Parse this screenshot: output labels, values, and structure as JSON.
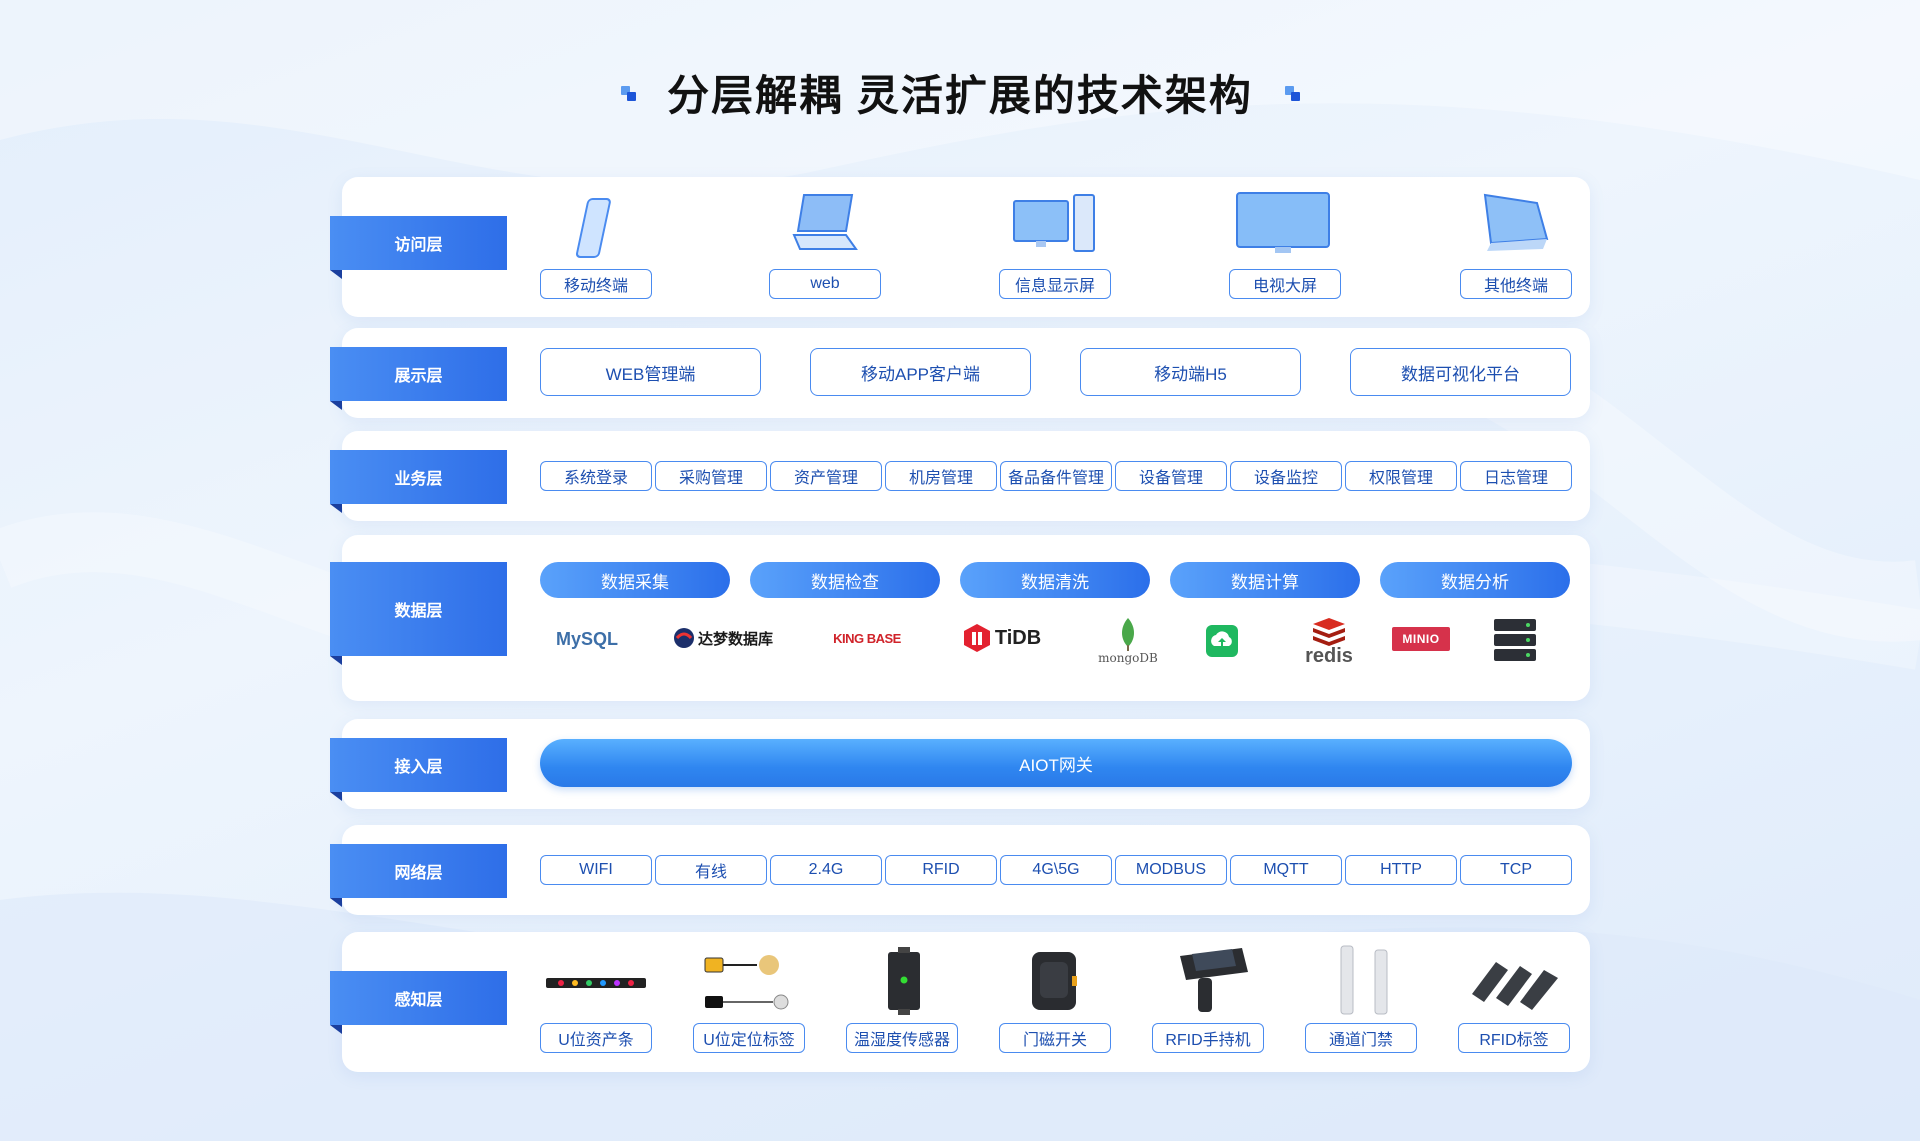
{
  "title": "分层解耦 灵活扩展的技术架构",
  "colors": {
    "primary": "#2e6ee8",
    "pill_border": "#4a8bf0",
    "pill_text": "#1d4fb0"
  },
  "layers": {
    "access": {
      "label": "访问层",
      "items": [
        {
          "label": "移动终端",
          "icon": "mobile-phone-icon"
        },
        {
          "label": "web",
          "icon": "laptop-icon"
        },
        {
          "label": "信息显示屏",
          "icon": "desktop-computer-icon"
        },
        {
          "label": "电视大屏",
          "icon": "tv-screen-icon"
        },
        {
          "label": "其他终端",
          "icon": "tablet-icon"
        }
      ]
    },
    "display": {
      "label": "展示层",
      "items": [
        "WEB管理端",
        "移动APP客户端",
        "移动端H5",
        "数据可视化平台"
      ]
    },
    "business": {
      "label": "业务层",
      "items": [
        "系统登录",
        "采购管理",
        "资产管理",
        "机房管理",
        "备品备件管理",
        "设备管理",
        "设备监控",
        "权限管理",
        "日志管理"
      ]
    },
    "data": {
      "label": "数据层",
      "stages": [
        "数据采集",
        "数据检查",
        "数据清洗",
        "数据计算",
        "数据分析"
      ],
      "logos": [
        {
          "text": "MySQL",
          "icon": "mysql-logo"
        },
        {
          "text": "达梦数据库",
          "icon": "dameng-logo"
        },
        {
          "text": "KING BASE",
          "icon": "kingbase-logo"
        },
        {
          "text": "TiDB",
          "icon": "tidb-logo"
        },
        {
          "text": "mongoDB",
          "icon": "mongodb-logo"
        },
        {
          "text": "",
          "icon": "cloud-upload-logo"
        },
        {
          "text": "redis",
          "icon": "redis-logo"
        },
        {
          "text": "MINIO",
          "icon": "minio-logo"
        },
        {
          "text": "",
          "icon": "server-stack-logo"
        }
      ]
    },
    "ingress": {
      "label": "接入层",
      "gateway": "AIOT网关"
    },
    "network": {
      "label": "网络层",
      "items": [
        "WIFI",
        "有线",
        "2.4G",
        "RFID",
        "4G\\5G",
        "MODBUS",
        "MQTT",
        "HTTP",
        "TCP"
      ]
    },
    "perception": {
      "label": "感知层",
      "items": [
        {
          "label": "U位资产条",
          "icon": "u-asset-strip-icon"
        },
        {
          "label": "U位定位标签",
          "icon": "u-location-tag-icon"
        },
        {
          "label": "温湿度传感器",
          "icon": "temp-humidity-sensor-icon"
        },
        {
          "label": "门磁开关",
          "icon": "door-magnetic-switch-icon"
        },
        {
          "label": "RFID手持机",
          "icon": "rfid-handheld-icon"
        },
        {
          "label": "通道门禁",
          "icon": "access-gate-icon"
        },
        {
          "label": "RFID标签",
          "icon": "rfid-tag-icon"
        }
      ]
    }
  }
}
